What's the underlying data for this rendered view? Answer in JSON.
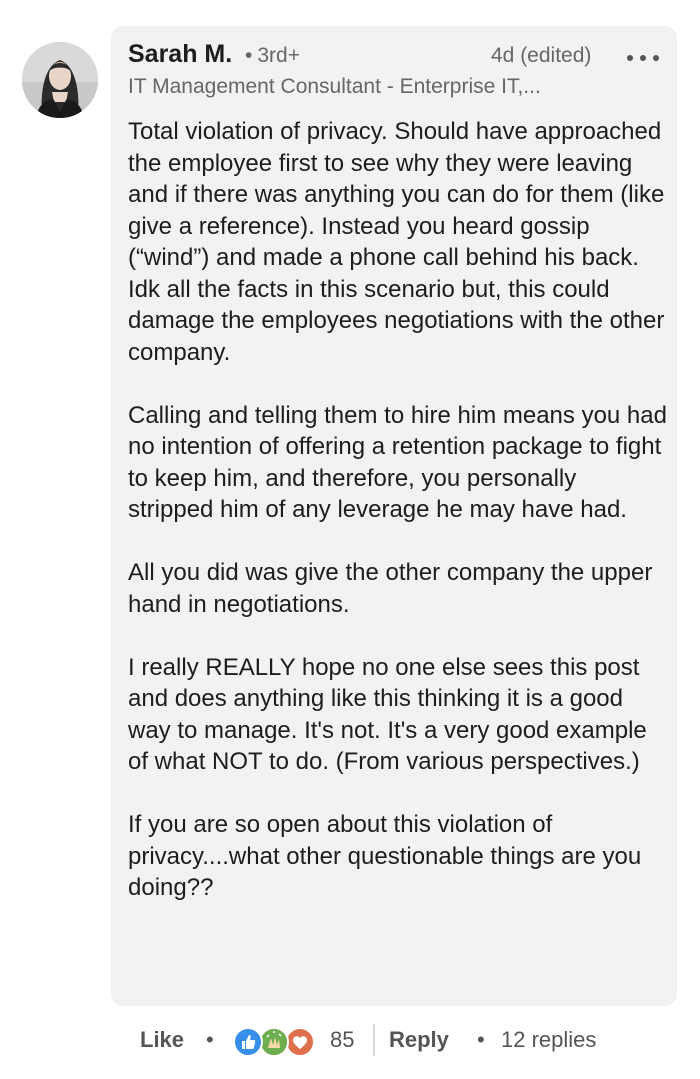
{
  "comment": {
    "author": {
      "name": "Sarah M.",
      "degree": "3rd+",
      "headline": "IT Management Consultant - Enterprise IT,..."
    },
    "timestamp": "4d (edited)",
    "paragraphs": [
      "Total violation of privacy. Should have approached the employee first to see why they were leaving and if there was anything you can do for them (like give a reference). Instead you heard gossip (“wind”) and made a phone call behind his back. Idk all the facts in this scenario but, this could damage the employees negotiations with the other company.",
      "Calling and telling them to hire him means you had no intention of offering a retention package to fight to keep him, and therefore, you personally stripped him of any leverage he may have had.",
      "All you did was give the other company the upper hand in negotiations.",
      "I really REALLY hope no one else sees this post and does anything like this thinking it is a good way to manage. It's not. It's a very good example of what NOT to do. (From various perspectives.)",
      "If you are so open about this violation of privacy....what other questionable things are you doing??"
    ]
  },
  "actions": {
    "like_label": "Like",
    "separator": "•",
    "reaction_count": "85",
    "reactions": [
      "like-icon",
      "celebrate-icon",
      "love-icon"
    ],
    "reply_label": "Reply",
    "replies_label": "12 replies"
  },
  "colors": {
    "bubble_background": "#f2f2f2",
    "text_primary": "#1d1d1f",
    "text_secondary": "#666666",
    "like_blue": "#378fe9",
    "celebrate_green": "#44712e",
    "love_red": "#df704d"
  }
}
